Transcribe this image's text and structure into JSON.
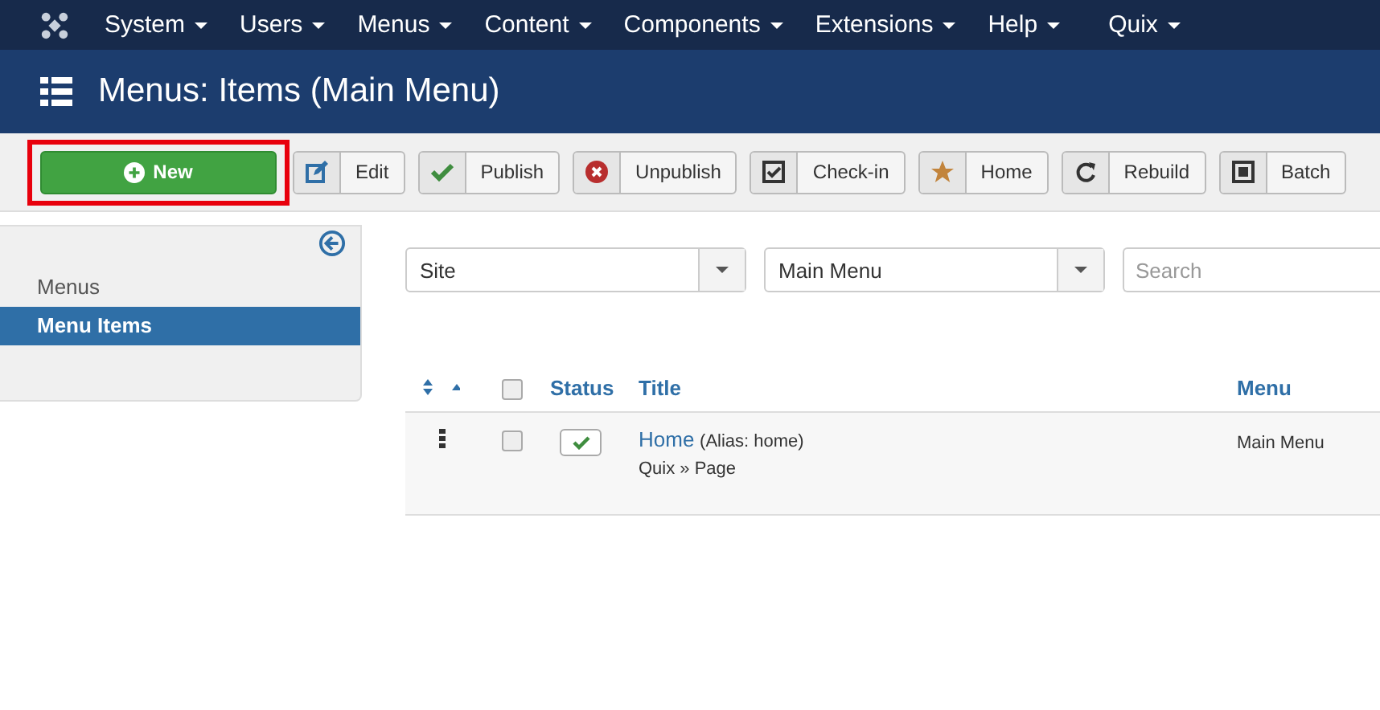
{
  "nav": {
    "items": [
      {
        "label": "System"
      },
      {
        "label": "Users"
      },
      {
        "label": "Menus"
      },
      {
        "label": "Content"
      },
      {
        "label": "Components"
      },
      {
        "label": "Extensions"
      },
      {
        "label": "Help"
      },
      {
        "label": "Quix"
      }
    ]
  },
  "header": {
    "title": "Menus: Items (Main Menu)"
  },
  "toolbar": [
    {
      "kind": "new",
      "label": "New",
      "highlighted": true
    },
    {
      "kind": "edit",
      "label": "Edit",
      "highlighted": false
    },
    {
      "kind": "publish",
      "label": "Publish",
      "highlighted": false
    },
    {
      "kind": "unpublish",
      "label": "Unpublish",
      "highlighted": false
    },
    {
      "kind": "checkin",
      "label": "Check-in",
      "highlighted": false
    },
    {
      "kind": "home",
      "label": "Home",
      "highlighted": false
    },
    {
      "kind": "rebuild",
      "label": "Rebuild",
      "highlighted": false
    },
    {
      "kind": "batch",
      "label": "Batch",
      "highlighted": false
    }
  ],
  "sidebar": {
    "items": [
      {
        "label": "Menus",
        "selected": false
      },
      {
        "label": "Menu Items",
        "selected": true
      }
    ]
  },
  "filters": {
    "client": "Site",
    "menu": "Main Menu",
    "search": {
      "placeholder": "Search"
    }
  },
  "table": {
    "select_all": false,
    "columns": [
      "Status",
      "Title",
      "Menu"
    ],
    "rows": [
      {
        "title": "Home",
        "alias": "(Alias: home)",
        "type": "Quix » Page",
        "menu": "Main Menu",
        "published": true,
        "checked": false
      }
    ]
  }
}
